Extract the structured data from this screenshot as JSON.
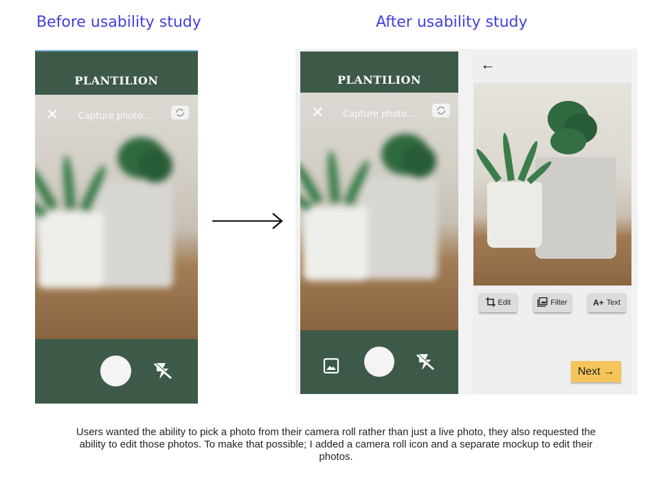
{
  "headings": {
    "before": "Before usability study",
    "after": "After usability study"
  },
  "brand": "PLANTILION",
  "camera": {
    "capture_label": "Capture photo...",
    "close_glyph": "✕"
  },
  "editor": {
    "back_glyph": "←",
    "tools": [
      {
        "label": "Edit",
        "icon": "crop-icon"
      },
      {
        "label": "Filter",
        "icon": "filter-icon"
      },
      {
        "label": "Text",
        "icon": "text-icon",
        "icon_text": "A+"
      }
    ],
    "next_label": "Next →"
  },
  "caption": "Users wanted the ability to pick a photo from their camera roll rather than just a live photo, they also requested the ability to edit those photos. To make that possible; I added a camera roll icon and a separate mockup to edit their photos.",
  "colors": {
    "brand_green": "#3d5a48",
    "heading_blue": "#3f3fe0",
    "next_yellow": "#f4c55b"
  }
}
